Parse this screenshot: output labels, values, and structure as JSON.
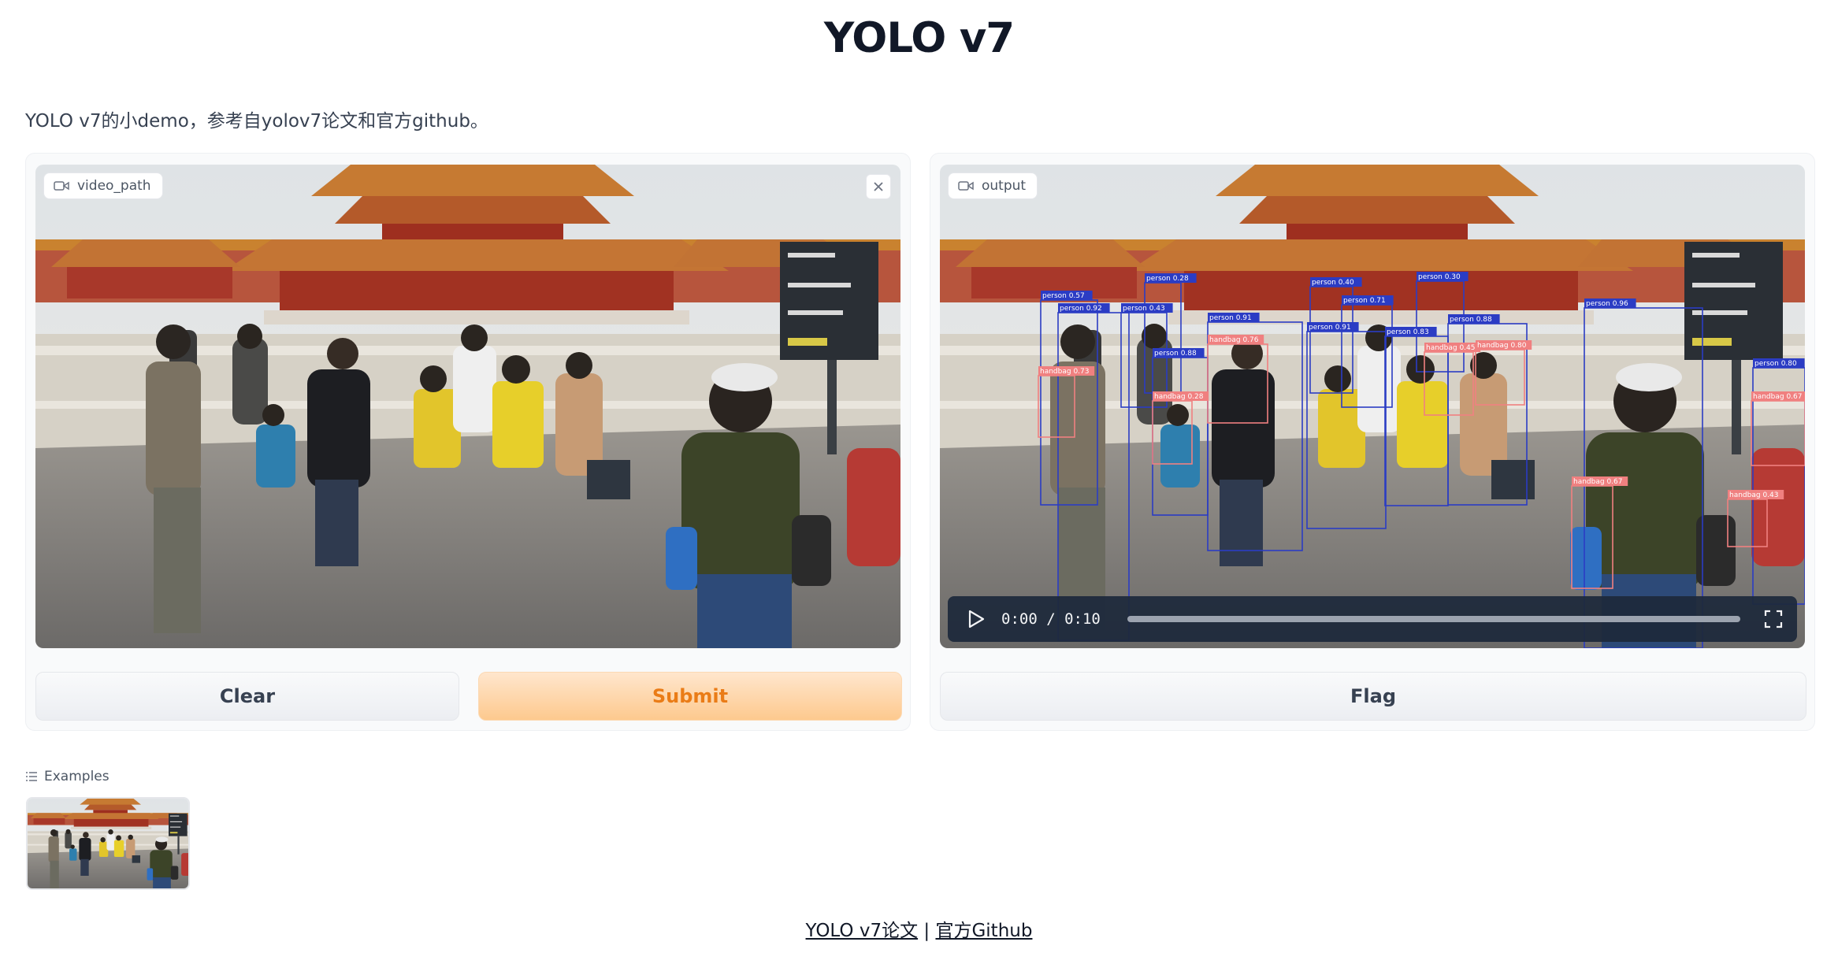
{
  "page": {
    "title": "YOLO v7",
    "description": "YOLO v7的小demo，参考自yolov7论文和官方github。"
  },
  "input_panel": {
    "label": "video_path",
    "clear_label": "Clear",
    "submit_label": "Submit"
  },
  "output_panel": {
    "label": "output",
    "time": "0:00 / 0:10",
    "flag_label": "Flag"
  },
  "examples": {
    "label": "Examples"
  },
  "footer": {
    "paper_link": "YOLO v7论文",
    "separator": " | ",
    "github_link": "官方Github"
  },
  "detections": [
    {
      "label": "person 0.57"
    },
    {
      "label": "person 0.92"
    },
    {
      "label": "person 0.28"
    },
    {
      "label": "person 0.43"
    },
    {
      "label": "person 0.91"
    },
    {
      "label": "person 0.40"
    },
    {
      "label": "person 0.71"
    },
    {
      "label": "person 0.30"
    },
    {
      "label": "person 0.91"
    },
    {
      "label": "person 0.83"
    },
    {
      "label": "person 0.88"
    },
    {
      "label": "person 0.96"
    },
    {
      "label": "person 0.88"
    },
    {
      "label": "person 0.80"
    },
    {
      "label": "handbag 0.73"
    },
    {
      "label": "handbag 0.76"
    },
    {
      "label": "handbag 0.28"
    },
    {
      "label": "handbag 0.45"
    },
    {
      "label": "handbag 0.80"
    },
    {
      "label": "handbag 0.67"
    },
    {
      "label": "handbag 0.67"
    },
    {
      "label": "handbag 0.43"
    }
  ],
  "colors": {
    "accent_orange": "#ea7c17",
    "person_box": "#2b3cc4",
    "handbag_box": "#f08080"
  }
}
